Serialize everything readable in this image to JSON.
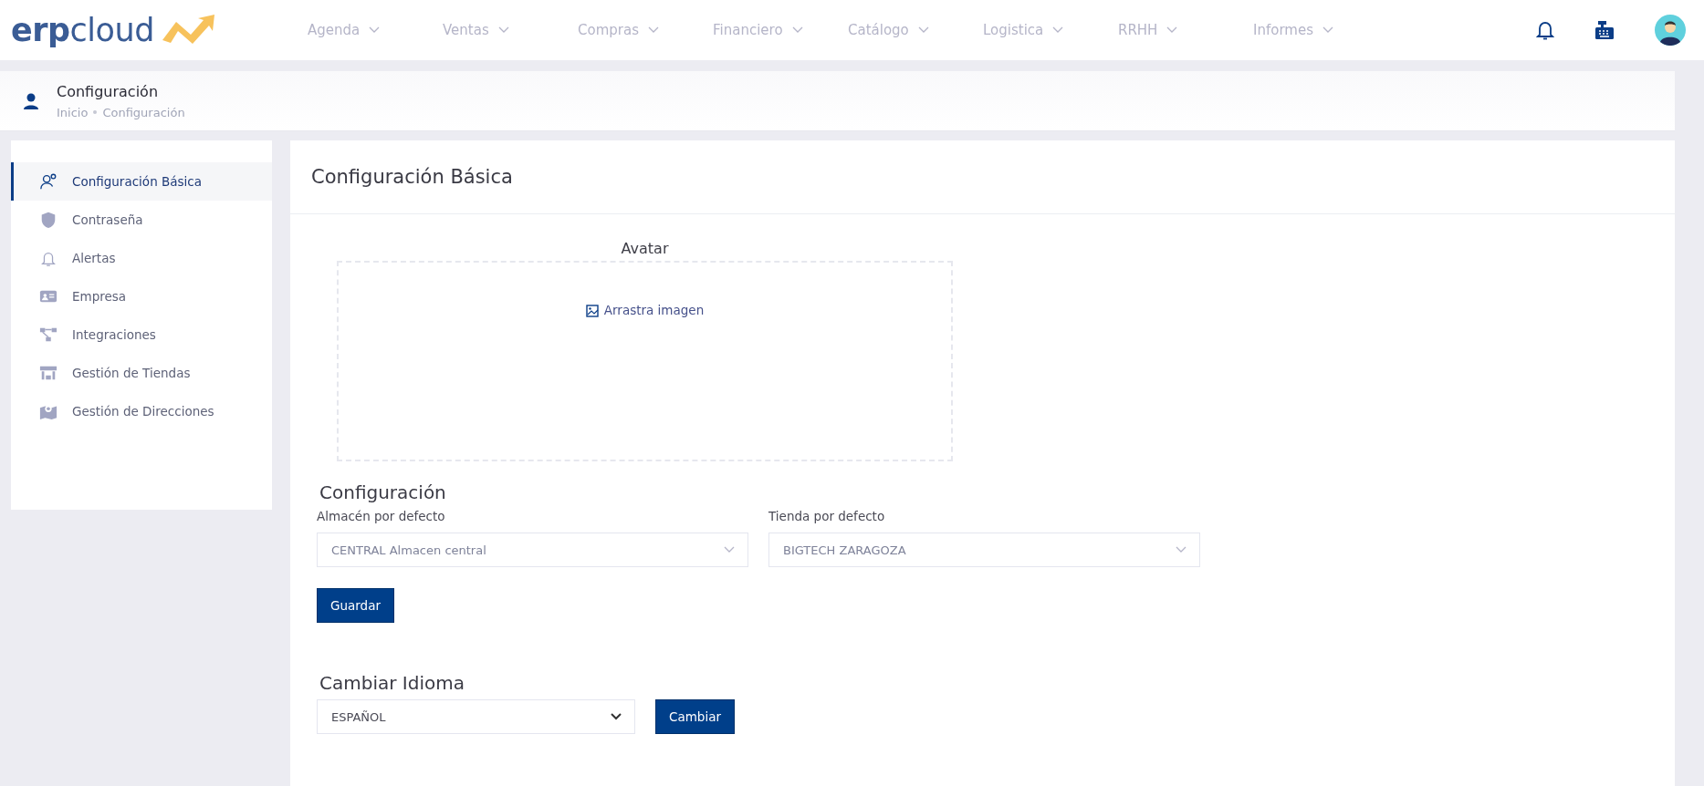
{
  "logo": "**erp**cloud",
  "nav": [
    {
      "label": "Agenda"
    },
    {
      "label": "Ventas"
    },
    {
      "label": "Compras"
    },
    {
      "label": "Financiero"
    },
    {
      "label": "Catálogo"
    },
    {
      "label": "Logistica"
    },
    {
      "label": "RRHH"
    },
    {
      "label": "Informes"
    }
  ],
  "page_header": {
    "title": "Configuración",
    "breadcrumb": [
      "Inicio",
      "Configuración"
    ]
  },
  "sidebar": {
    "items": [
      {
        "label": "Configuración Básica",
        "selected": true
      },
      {
        "label": "Contraseña",
        "selected": false
      },
      {
        "label": "Alertas",
        "selected": false
      },
      {
        "label": "Empresa",
        "selected": false
      },
      {
        "label": "Integraciones",
        "selected": false
      },
      {
        "label": "Gestión de Tiendas",
        "selected": false
      },
      {
        "label": "Gestión de Direcciones",
        "selected": false
      }
    ]
  },
  "main": {
    "title": "Configuración Básica",
    "avatar_label": "Avatar",
    "dropzone_text": "Arrastra imagen",
    "config": {
      "heading": "Configuración",
      "fields": [
        {
          "label": "Almacén por defecto",
          "value": "CENTRAL Almacen central"
        },
        {
          "label": "Tienda por defecto",
          "value": "BIGTECH ZARAGOZA"
        }
      ],
      "save_button": "Guardar"
    },
    "language": {
      "heading": "Cambiar Idioma",
      "value": "ESPAÑOL",
      "button": "Cambiar"
    }
  }
}
